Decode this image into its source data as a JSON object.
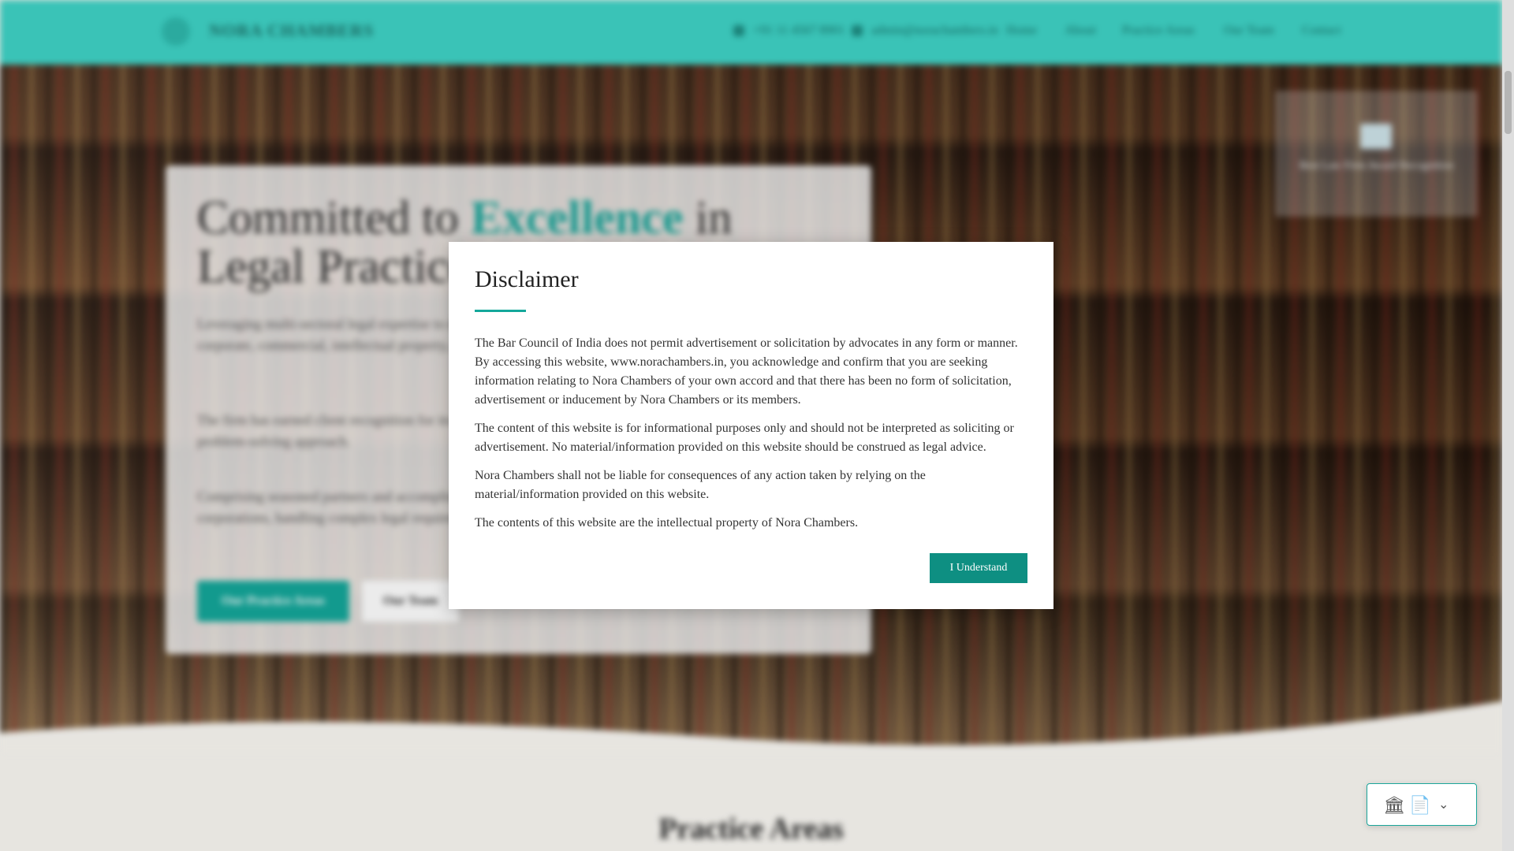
{
  "header": {
    "brand": "NORA CHAMBERS",
    "phone": "+91 11 4567 8901",
    "email": "admin@norachambers.in",
    "nav": [
      "Home",
      "About",
      "Practice Areas",
      "Our Team",
      "Contact"
    ]
  },
  "hero": {
    "title_part1": "Committed to ",
    "title_accent": "Excellence",
    "title_part2": " in Legal Practice",
    "para1": "Leveraging multi-sectoral legal expertise to deliver focused representation and tailored counsel across corporate, commercial, intellectual property, securities law, disputes and more.",
    "para2": "The firm has earned client recognition for its commitment to quality and its attorneys' innovative problem-solving approach.",
    "para3": "Comprising seasoned partners and accomplished associates, we advise as counsel to prominent corporations, handling complex legal requirements with legal proficiency.",
    "primary_button": "Our Practice Areas",
    "secondary_button": "Our Team",
    "side_card_text": "Best Law Firm Award Recognition"
  },
  "sections": {
    "practice_title": "Practice Areas"
  },
  "disclaimer": {
    "title": "Disclaimer",
    "paragraphs": [
      "The Bar Council of India does not permit advertisement or solicitation by advocates in any form or manner. By accessing this website, www.norachambers.in, you acknowledge and confirm that you are seeking information relating to Nora Chambers of your own accord and that there has been no form of solicitation, advertisement or inducement by Nora Chambers or its members.",
      "The content of this website is for informational purposes only and should not be interpreted as soliciting or advertisement. No material/information provided on this website should be construed as legal advice.",
      "Nora Chambers shall not be liable for consequences of any action taken by relying on the material/information provided on this website.",
      "The contents of this website are the intellectual property of Nora Chambers."
    ],
    "button": "I Understand"
  },
  "widget": {
    "icons": [
      "bank-icon",
      "document-icon",
      "chevron-down-icon"
    ]
  },
  "colors": {
    "header": "#3fd4c7",
    "accent": "#14a89b",
    "button": "#0e8f82"
  }
}
